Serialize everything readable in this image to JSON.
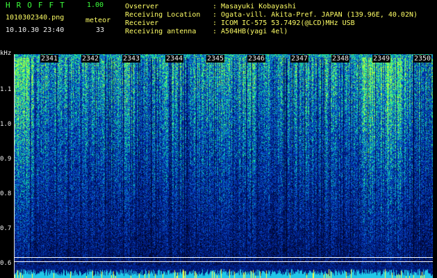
{
  "header": {
    "app_name": "HROFFT",
    "version": "1.00",
    "filename": "1010302340.png",
    "datetime": "10.10.30 23:40",
    "meteor_label": "meteor",
    "meteor_count": "33"
  },
  "info": [
    {
      "label": "Ovserver",
      "value": ": Masayuki Kobayashi"
    },
    {
      "label": "Receiving Location",
      "value": ": Ogata-vill. Akita-Pref. JAPAN (139.96E, 40.02N)"
    },
    {
      "label": "Receiver",
      "value": ": ICOM IC-575 53.7492(@LCD)MHz USB"
    },
    {
      "label": "Receiving antenna",
      "value": ": A504HB(yagi 4el)"
    }
  ],
  "axis": {
    "unit": "kHz",
    "y_ticks": [
      "1.1",
      "1.0",
      "0.9",
      "0.8",
      "0.7",
      "0.6"
    ],
    "x_ticks": [
      "2341",
      "2342",
      "2343",
      "2344",
      "2345",
      "2346",
      "2347",
      "2348",
      "2349",
      "2350"
    ]
  },
  "colors": {
    "header_green": "#3cff3c",
    "header_yellow": "#ffff66",
    "spectrogram_low": "#0a1a6e",
    "spectrogram_high": "#9dff4a"
  }
}
